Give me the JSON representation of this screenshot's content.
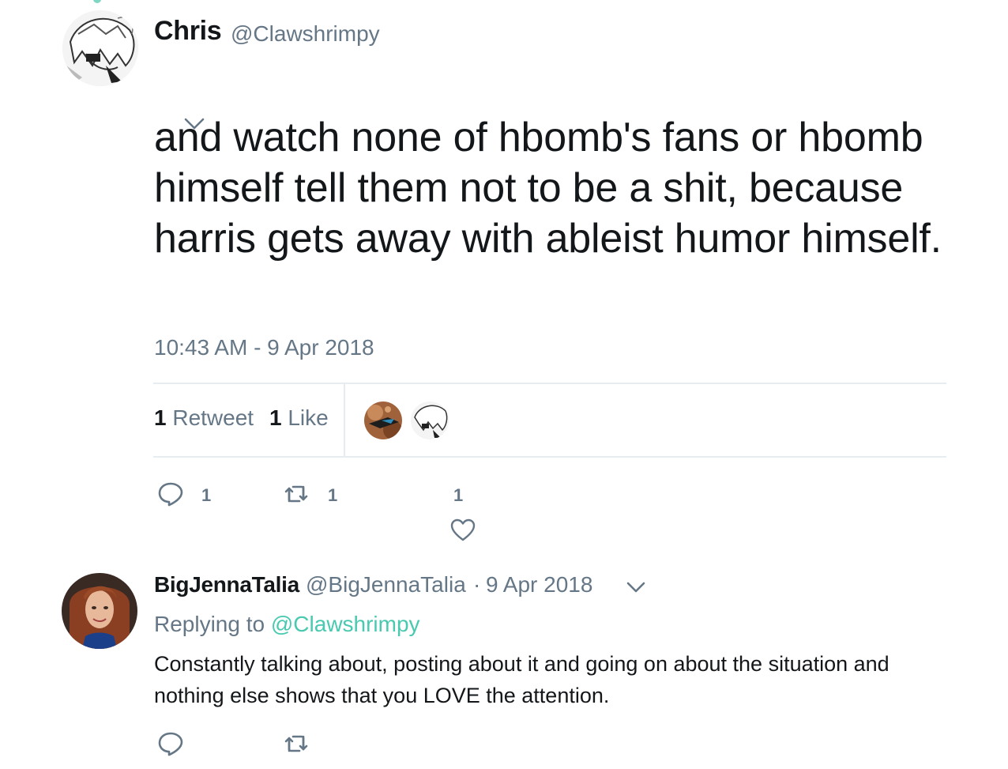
{
  "main_tweet": {
    "author_name": "Chris",
    "author_handle": "@Clawshrimpy",
    "text": "and watch none of hbomb's fans or hbomb himself tell them not to be a shit, because harris gets away with ableist humor himself.",
    "timestamp": "10:43 AM - 9 Apr 2018",
    "stats": {
      "retweet_count": "1",
      "retweet_label": "Retweet",
      "like_count": "1",
      "like_label": "Like"
    },
    "actions": {
      "reply_count": "1",
      "retweet_count": "1",
      "like_count": "1"
    }
  },
  "reply_tweet": {
    "author_name": "BigJennaTalia",
    "author_handle": "@BigJennaTalia",
    "separator": "·",
    "date": "9 Apr 2018",
    "replying_to_label": "Replying to",
    "replying_to_handle": "@Clawshrimpy",
    "text": "Constantly talking about, posting about it and going on about the situation and nothing else shows that you LOVE the attention."
  },
  "colors": {
    "text_primary": "#14171a",
    "text_secondary": "#657786",
    "accent": "#48c9b0",
    "divider": "#e6ecf0"
  },
  "icons": [
    "reply-icon",
    "retweet-icon",
    "like-icon",
    "chevron-down-icon"
  ]
}
